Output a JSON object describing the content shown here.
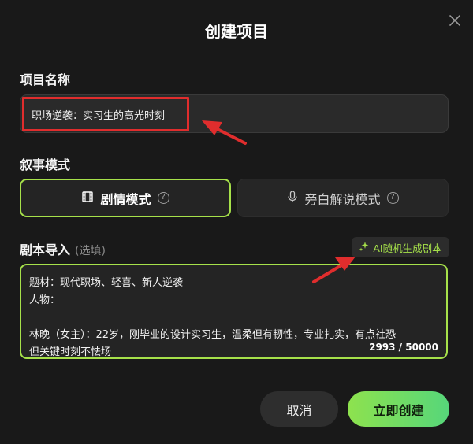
{
  "dialog": {
    "title": "创建项目",
    "close_icon": "close-icon"
  },
  "project_name": {
    "label": "项目名称",
    "value": "职场逆袭：实习生的高光时刻"
  },
  "narrative_mode": {
    "label": "叙事模式",
    "options": [
      {
        "label": "剧情模式",
        "icon": "film-icon",
        "selected": true
      },
      {
        "label": "旁白解说模式",
        "icon": "microphone-icon",
        "selected": false
      }
    ],
    "help_icon": "question-circle-icon"
  },
  "script_import": {
    "label": "剧本导入",
    "hint": "(选填)",
    "ai_button": {
      "label": "AI随机生成剧本",
      "icon": "sparkle-icon"
    },
    "lines": [
      "题材：现代职场、轻喜、新人逆袭",
      "人物：",
      "",
      "林晚（女主）：22岁，刚毕业的设计实习生，温柔但有韧性，专业扎实，有点社恐",
      "但关键时刻不怯场"
    ],
    "counter": "2993 / 50000"
  },
  "footer": {
    "cancel_label": "取消",
    "create_label": "立即创建"
  },
  "colors": {
    "accent": "#a6e14a",
    "annotation": "#e02d2d",
    "background": "#191919"
  }
}
